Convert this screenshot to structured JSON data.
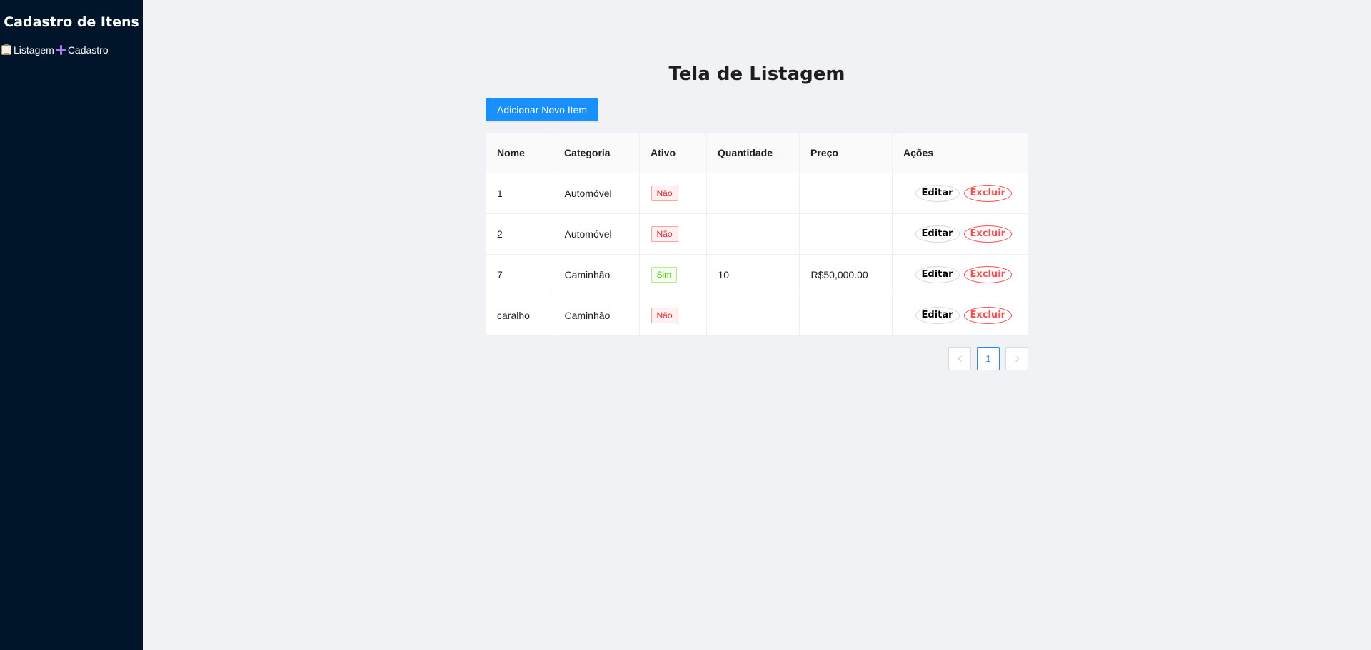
{
  "sidebar": {
    "title": "Cadastro de Itens",
    "nav": [
      {
        "label": "Listagem",
        "icon": "clipboard-icon"
      },
      {
        "label": "Cadastro",
        "icon": "plus-icon"
      }
    ]
  },
  "main": {
    "title": "Tela de Listagem",
    "add_button_label": "Adicionar Novo Item"
  },
  "table": {
    "columns": [
      "Nome",
      "Categoria",
      "Ativo",
      "Quantidade",
      "Preço",
      "Ações"
    ],
    "rows": [
      {
        "nome": "1",
        "categoria": "Automóvel",
        "ativo": "Não",
        "quantidade": "",
        "preco": ""
      },
      {
        "nome": "2",
        "categoria": "Automóvel",
        "ativo": "Não",
        "quantidade": "",
        "preco": ""
      },
      {
        "nome": "7",
        "categoria": "Caminhão",
        "ativo": "Sim",
        "quantidade": "10",
        "preco": "R$50,000.00"
      },
      {
        "nome": "caralho",
        "categoria": "Caminhão",
        "ativo": "Não",
        "quantidade": "",
        "preco": ""
      }
    ],
    "edit_label": "Editar",
    "delete_label": "Excluir"
  },
  "pagination": {
    "current_page": "1"
  },
  "colors": {
    "sidebar_bg": "#001529",
    "primary": "#1890ff",
    "danger": "#ff4d4f",
    "tag_no": "#f5222d",
    "tag_yes": "#52c41a",
    "page_bg": "#f0f2f5"
  }
}
